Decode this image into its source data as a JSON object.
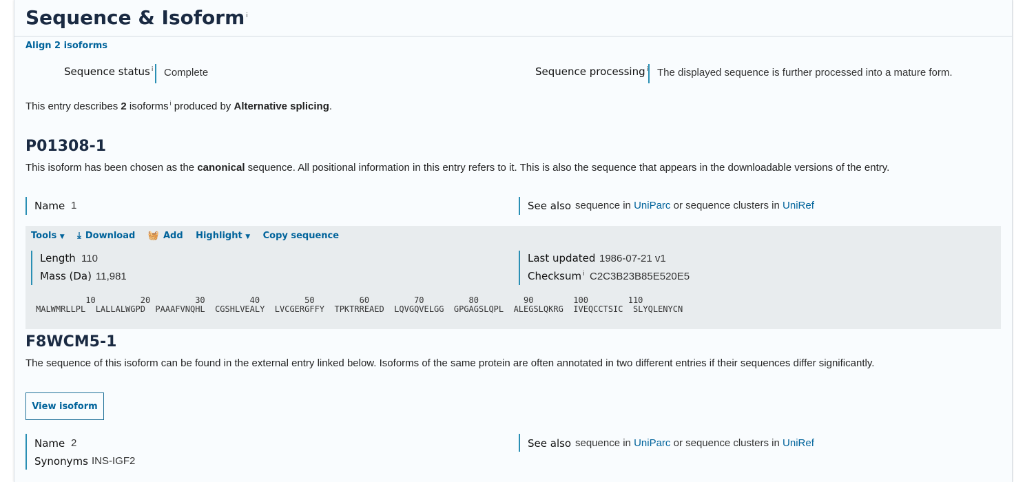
{
  "section": {
    "title": "Sequence & Isoform",
    "info_marker": "i",
    "align_link": "Align 2 isoforms"
  },
  "status": {
    "seq_status_label": "Sequence status",
    "seq_status_value": "Complete",
    "seq_processing_label": "Sequence processing",
    "seq_processing_value": "The displayed sequence is further processed into a mature form."
  },
  "entry_desc": {
    "prefix": "This entry describes ",
    "count": "2",
    "mid1": " isoforms",
    "mid2": " produced by ",
    "mechanism": "Alternative splicing",
    "suffix": "."
  },
  "isoform1": {
    "id": "P01308-1",
    "desc_prefix": "This isoform has been chosen as the ",
    "desc_bold": "canonical",
    "desc_suffix": " sequence. All positional information in this entry refers to it. This is also the sequence that appears in the downloadable versions of the entry.",
    "name_label": "Name",
    "name_value": "1",
    "see_also_label": "See also",
    "see_also_text1": "sequence in ",
    "uniparc": "UniParc",
    "see_also_text2": " or sequence clusters in ",
    "uniref": "UniRef",
    "tools": [
      "Tools",
      "Download",
      "Add",
      "Highlight",
      "Copy sequence"
    ],
    "length_label": "Length",
    "length_value": "110",
    "mass_label": "Mass (Da)",
    "mass_value": "11,981",
    "updated_label": "Last updated",
    "updated_value": "1986-07-21 v1",
    "checksum_label": "Checksum",
    "checksum_value": "C2C3B23B85E520E5",
    "seq_numbers": "          10         20         30         40         50         60         70         80         90        100        110",
    "seq_line": "MALWMRLLPL  LALLALWGPD  PAAAFVNQHL  CGSHLVEALY  LVCGERGFFY  TPKTRREAED  LQVGQVELGG  GPGAGSLQPL  ALEGSLQKRG  IVEQCCTSIC  SLYQLENYCN"
  },
  "isoform2": {
    "id": "F8WCM5-1",
    "desc": "The sequence of this isoform can be found in the external entry linked below. Isoforms of the same protein are often annotated in two different entries if their sequences differ significantly.",
    "view_button": "View isoform",
    "name_label": "Name",
    "name_value": "2",
    "synonyms_label": "Synonyms",
    "synonyms_value": "INS-IGF2",
    "see_also_label": "See also",
    "see_also_text1": "sequence in ",
    "uniparc": "UniParc",
    "see_also_text2": " or sequence clusters in ",
    "uniref": "UniRef"
  },
  "colors": {
    "accent": "#2a8fb4",
    "link": "#00639b",
    "title": "#1a2a42",
    "seq_bg": "#e8ecee"
  },
  "icons": [
    "caret-down-icon",
    "download-icon",
    "basket-icon"
  ]
}
